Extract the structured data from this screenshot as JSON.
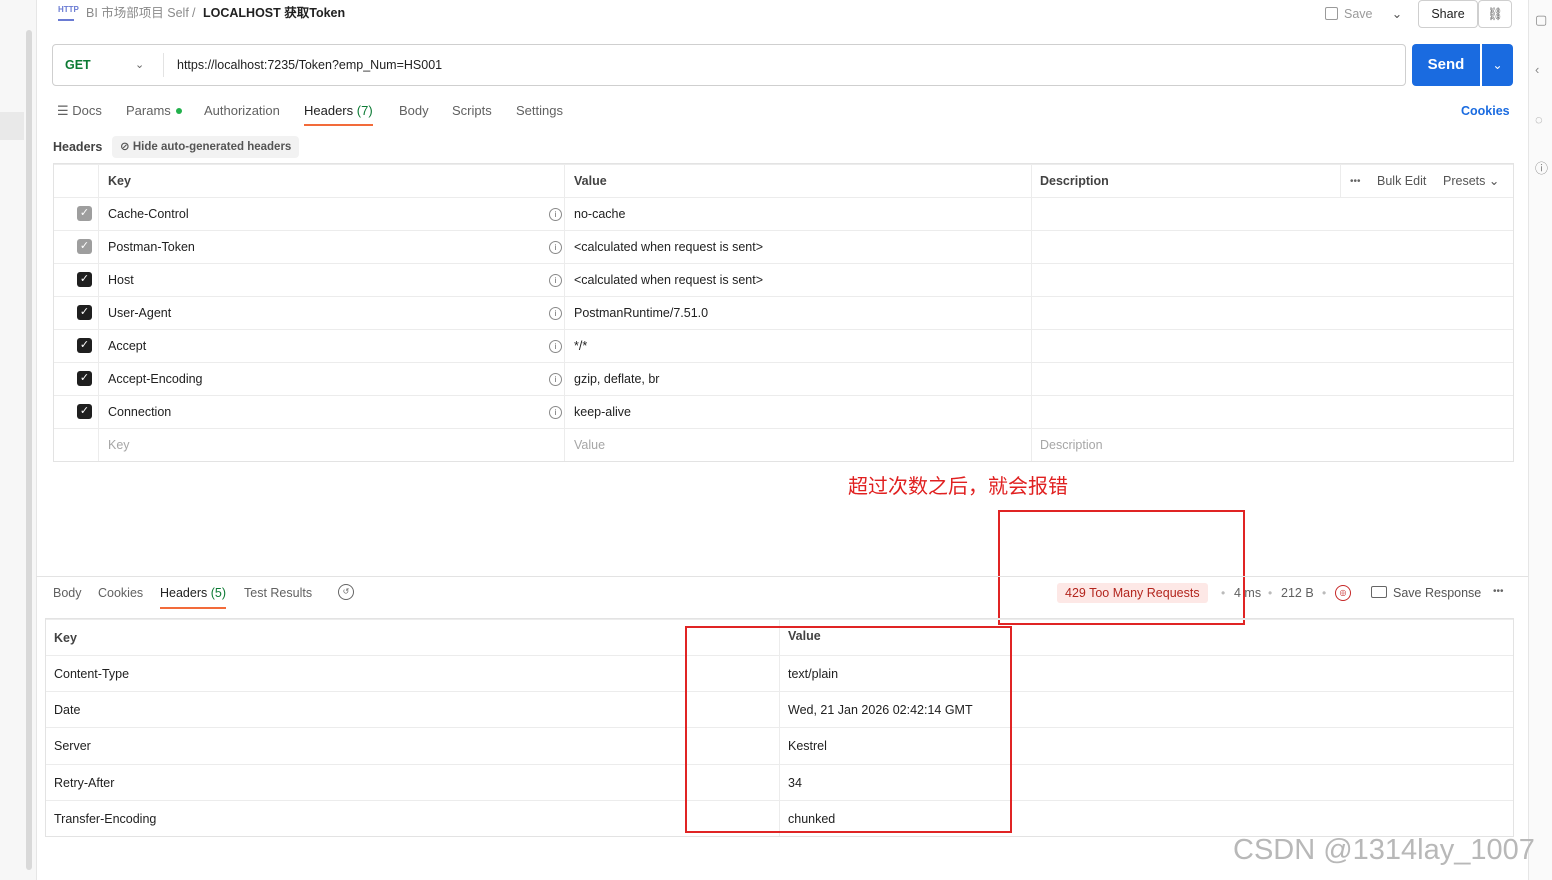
{
  "breadcrumb": {
    "icon": "http-icon",
    "workspace": "BI 市场部项目 Self",
    "separator": "/",
    "request_name": "LOCALHOST 获取Token"
  },
  "toolbar": {
    "save_label": "Save",
    "save_dropdown": "⌄",
    "share_label": "Share",
    "link_icon": "🔗"
  },
  "request": {
    "method": "GET",
    "method_chevron": "⌄",
    "url": "https://localhost:7235/Token?emp_Num=HS001",
    "send_label": "Send",
    "send_dropdown": "⌄"
  },
  "request_tabs": [
    {
      "label": "Docs",
      "icon": "docs-icon"
    },
    {
      "label": "Params"
    },
    {
      "label": "Authorization"
    },
    {
      "label": "Headers",
      "count": "(7)",
      "active": true
    },
    {
      "label": "Body"
    },
    {
      "label": "Scripts"
    },
    {
      "label": "Settings"
    }
  ],
  "cookies_label": "Cookies",
  "headers_section": {
    "title": "Headers",
    "hide_auto_label": "Hide auto-generated headers",
    "columns": {
      "key": "Key",
      "value": "Value",
      "description": "Description"
    },
    "bulk_edit": "Bulk Edit",
    "presets": "Presets ⌄",
    "more": "•••",
    "rows": [
      {
        "key": "Cache-Control",
        "value": "no-cache",
        "checked": "grey"
      },
      {
        "key": "Postman-Token",
        "value": "<calculated when request is sent>",
        "checked": "grey"
      },
      {
        "key": "Host",
        "value": "<calculated when request is sent>",
        "checked": "black"
      },
      {
        "key": "User-Agent",
        "value": "PostmanRuntime/7.51.0",
        "checked": "black"
      },
      {
        "key": "Accept",
        "value": "*/*",
        "checked": "black"
      },
      {
        "key": "Accept-Encoding",
        "value": "gzip, deflate, br",
        "checked": "black"
      },
      {
        "key": "Connection",
        "value": "keep-alive",
        "checked": "black"
      }
    ],
    "placeholder": {
      "key": "Key",
      "value": "Value",
      "description": "Description"
    }
  },
  "annotation": {
    "text": "超过次数之后，就会报错",
    "color": "#e02020"
  },
  "response_tabs": [
    {
      "label": "Body"
    },
    {
      "label": "Cookies"
    },
    {
      "label": "Headers",
      "count": "(5)",
      "active": true
    },
    {
      "label": "Test Results"
    }
  ],
  "response_meta": {
    "status": "429 Too Many Requests",
    "time": "4 ms",
    "size": "212 B",
    "save_response": "Save Response",
    "more": "•••"
  },
  "response_headers": {
    "columns": {
      "key": "Key",
      "value": "Value"
    },
    "rows": [
      {
        "key": "Content-Type",
        "value": "text/plain"
      },
      {
        "key": "Date",
        "value": "Wed, 21 Jan 2026 02:42:14 GMT"
      },
      {
        "key": "Server",
        "value": "Kestrel"
      },
      {
        "key": "Retry-After",
        "value": "34"
      },
      {
        "key": "Transfer-Encoding",
        "value": "chunked"
      }
    ]
  },
  "watermark": "CSDN @1314lay_1007",
  "colors": {
    "accent": "#1a6be0",
    "active_tab": "#f26b3a",
    "method_get": "#0c7a34",
    "status_error": "#b3261e"
  }
}
